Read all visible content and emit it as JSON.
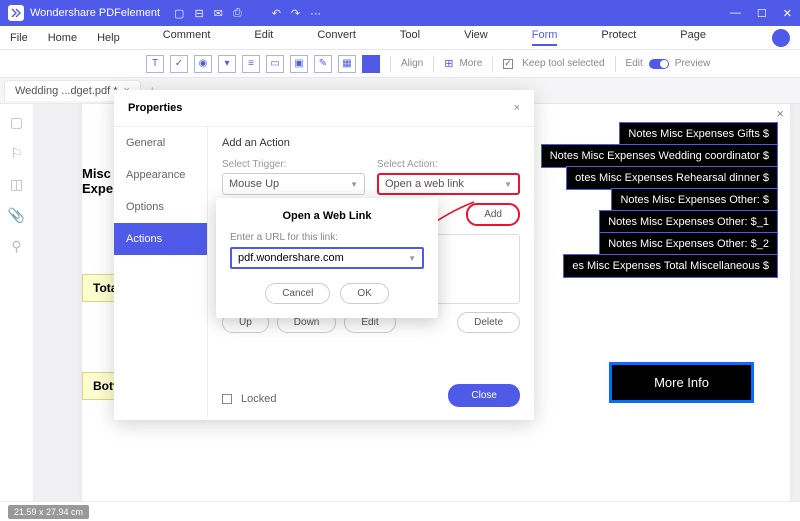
{
  "app": {
    "name": "Wondershare PDFelement"
  },
  "menu": {
    "file": "File",
    "home": "Home",
    "help": "Help",
    "center": [
      "Comment",
      "Edit",
      "Convert",
      "Tool",
      "View",
      "Form",
      "Protect",
      "Page"
    ],
    "active": "Form"
  },
  "toolbar": {
    "align": "Align",
    "more": "More",
    "keep": "Keep tool selected",
    "edit": "Edit",
    "preview": "Preview"
  },
  "tab": {
    "name": "Wedding ...dget.pdf *"
  },
  "doc": {
    "misc": "Misc\nExpe",
    "total": "Tota",
    "bott": "Bott",
    "black": [
      "Notes Misc Expenses Gifts $",
      "Notes Misc Expenses Wedding coordinator $",
      "otes Misc Expenses Rehearsal dinner $",
      "Notes Misc Expenses Other: $",
      "Notes Misc Expenses Other: $_1",
      "Notes Misc Expenses Other: $_2",
      "es Misc Expenses Total Miscellaneous $"
    ],
    "moreInfo": "More Info"
  },
  "props": {
    "title": "Properties",
    "tabs": {
      "general": "General",
      "appearance": "Appearance",
      "options": "Options",
      "actions": "Actions"
    },
    "sub": "Add an Action",
    "trigLbl": "Select Trigger:",
    "trigVal": "Mouse Up",
    "actLbl": "Select Action:",
    "actVal": "Open a web link",
    "add": "Add",
    "up": "Up",
    "down": "Down",
    "editb": "Edit",
    "delete": "Delete",
    "locked": "Locked",
    "close": "Close"
  },
  "url": {
    "title": "Open a Web Link",
    "label": "Enter a URL for this link:",
    "value": "pdf.wondershare.com",
    "cancel": "Cancel",
    "ok": "OK"
  },
  "status": {
    "dim": "21.59 x 27.94 cm"
  }
}
